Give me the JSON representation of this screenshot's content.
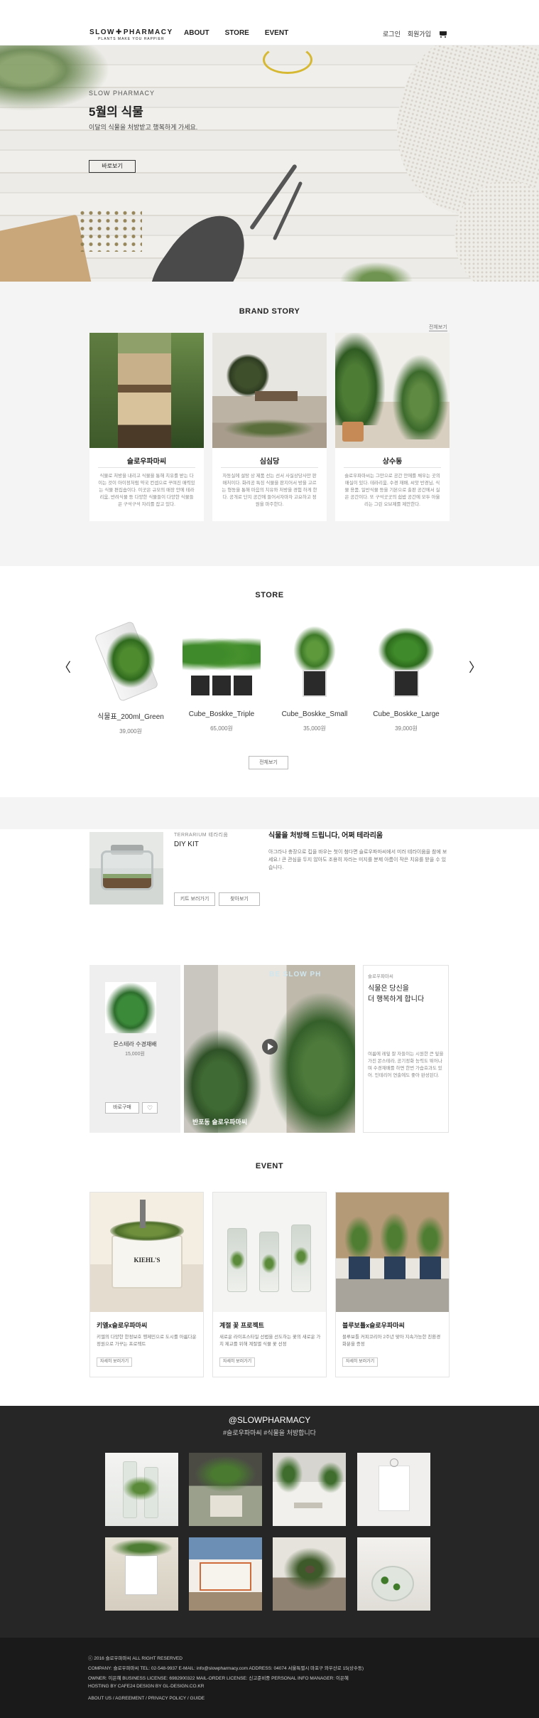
{
  "header": {
    "logo": "SLOW",
    "logo_right": "PHARMACY",
    "logo_tagline": "PLANTS MAKE YOU HAPPIER",
    "nav": [
      "ABOUT",
      "STORE",
      "EVENT"
    ],
    "login": "로그인",
    "join": "회원가입"
  },
  "hero": {
    "subtitle": "SLOW PHARMACY",
    "title": "5월의 식물",
    "desc": "이달의 식물을 처방받고 행복하게 가세요.",
    "button": "바로보기"
  },
  "brand": {
    "title": "BRAND STORY",
    "more": "전체보기",
    "cards": [
      {
        "name": "슬로우파마씨",
        "text": "식물로 처방을 내리고 식물을 통해 치유를 받는 다이는 것이 아이정처럼 약국 컨셉으로 꾸며진 매력있는 식물 편집숍이다. 이곳은 규모의 매장 안에 테라리움, 반려식물 등 다양한 식물들이 다양한 식물들은 구석구석 자리를 잡고 있다."
      },
      {
        "name": "심심당",
        "text": "자동실에 설탕 상 제품 선는 선서 사실상당사만 판매처이다. 화려공 특징 식물을 판지어서 방을 고르는 형동을 통해 마음의 치유와 처방을 경험 하게 한다. 공개로 단지 공간에 들어서자마자 고요하고 정원을 마주한다."
      },
      {
        "name": "상수동",
        "text": "슬로우파마씨는 그만으로 공간 안에를 채우는 곳의 매실이 있다. 테라리움, 수경 재배, 씨앗 반경님, 식물 용품, 일반식물 등을 기본으로 출판 공간에서 실은 공간이다. 또 구석곳곳의 쉽밥 공간에 모두 아울리는 그린 오브제를 제안한다."
      }
    ]
  },
  "store": {
    "title": "STORE",
    "prev": "〈",
    "next": "〉",
    "products": [
      {
        "name": "식물표_200ml_Green",
        "price": "39,000원"
      },
      {
        "name": "Cube_Boskke_Triple",
        "price": "65,000원"
      },
      {
        "name": "Cube_Boskke_Small",
        "price": "35,000원"
      },
      {
        "name": "Cube_Boskke_Large",
        "price": "39,000원"
      }
    ],
    "more": "전체보기"
  },
  "diy": {
    "tag": "TERRARIUM 테라리움",
    "kit": "DIY KIT",
    "headline": "식물을 처방해 드립니다, 어쩌 테라리움",
    "desc": "아그라나 충장으로 킵을 바우는 첫이 첨다면 슬로우파마씨에서 미러 테라이움을 참에 보세요.! 큰 관심을 두지 않아도 조용히 자라는 미지를 분제 아름이 작은 치유를 받을 수 있습니다.",
    "btn1": "키트 보러가기",
    "btn2": "찾아보기"
  },
  "feature": {
    "product_name": "몬스테라 수경재배",
    "product_price": "15,000원",
    "buy": "바로구매",
    "heart": "♡",
    "photo_sign": "BE SLOW PH",
    "caption": "반포동 슬로우파마씨",
    "tag": "슬로우파마씨",
    "title": "식물은 당신을\n더 행복하게 합니다",
    "desc": "여름에 레잎 잘 자들이는 시원한 큰 잎을 가진 몬스테라, 공기정화 능력도 뛰어나며 수경재배를 하면 한번 가습효과도 있어. 인테리어 연출에도 좋아 완성된다."
  },
  "event": {
    "title": "EVENT",
    "cards": [
      {
        "title": "키엘x슬로우파마씨",
        "desc": "키엘의 다양한 한정보호 행제민으로 도시를 아름다운 정원으로 가꾸는 프로젝트",
        "btn": "자세히 보러가기"
      },
      {
        "title": "계절 꽃 프로젝트",
        "desc": "새로운 라이프스타일 선법을 선도하는 꽃의 새로운 가치 제교를 위해 계절별 식물 꽃 선정",
        "btn": "자세히 보러가기"
      },
      {
        "title": "블루보틀x슬로우파마씨",
        "desc": "블루보틀 커피코리아 2주년 맞아 지속가능한 친환경 화분을 증정",
        "btn": "자세히 보러가기"
      }
    ],
    "kiehls_label": "KIEHL'S"
  },
  "instagram": {
    "handle": "@SLOWPHARMACY",
    "hashtags": "#슬로우파마씨 #식물을 처방합니다"
  },
  "footer": {
    "line1": "ⓒ 2016 슬로우파마씨 ALL RIGHT RESERVED",
    "line2": "COMPANY: 슬로우파마씨    TEL: 02-548-9937    E-MAIL: info@slowpharmacy.com    ADDRESS: 04074 서울특별시 마포구 와우산로 15(상수동)",
    "line3": "OWNER: 이은혜    BUSINESS LICENSE: 6982900322    MAIL-ORDER LICENSE: 신고준비중    PERSONAL INFO MANAGER: 이은혜",
    "line4": "HOSTING BY CAFE24 DESIGN BY GL-DESIGN.CO.KR",
    "links": "ABOUT US / AGREEMENT / PRIVACY POLICY / GUIDE"
  },
  "colors": {
    "accent": "#222222",
    "section_bg": "#f4f4f4",
    "dark_bg": "#262626",
    "footer_bg": "#1a1a1a"
  }
}
